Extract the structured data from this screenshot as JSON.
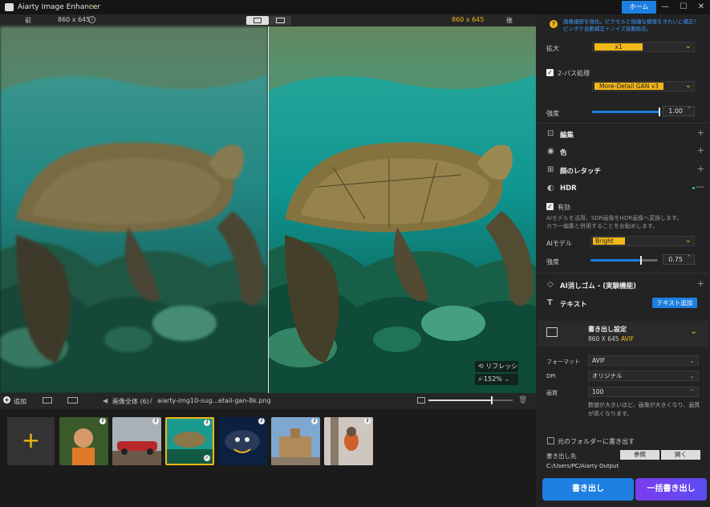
{
  "app": {
    "title": "Aiarty Image Enhancer",
    "home_label": "ホーム"
  },
  "compare": {
    "before_label": "前",
    "before_size": "860 x 645",
    "after_size": "860 x 645",
    "after_label": "後"
  },
  "overlay": {
    "refresh_label": "リフレッシュ",
    "zoom_value": "152%"
  },
  "bottom": {
    "add_label": "追加",
    "breadcrumb_all": "画像全体 (6)",
    "breadcrumb_sep": "/",
    "file_name": "aiarty-img10-sug...etail-gan-8k.png",
    "zoom_slider_value": 0.75
  },
  "thumbnails": [
    {
      "name": "child-photo",
      "selected": false
    },
    {
      "name": "red-car",
      "selected": false
    },
    {
      "name": "turtle",
      "selected": true
    },
    {
      "name": "dog",
      "selected": false
    },
    {
      "name": "castle",
      "selected": false
    },
    {
      "name": "bird",
      "selected": false
    }
  ],
  "panel": {
    "hint_line1": "画像細部を強化。ピクセルと微細な模様をきれいに補正！",
    "hint_line2": "ピンボケ自動補正＋ノイズ自動除去。",
    "scale_label": "拡大",
    "scale_value": "x1",
    "twopass_label": "2-パス処理",
    "twopass_checked": true,
    "twopass_model": "More-Detail GAN  v3",
    "strength_label": "強度",
    "strength_value": "1.00",
    "strength_fill": 1.0,
    "sections": {
      "edit": "編集",
      "color": "色",
      "face": "顔のレタッチ",
      "hdr": "HDR",
      "eraser": "AI消しゴム - (実験機能)",
      "text": "テキスト"
    },
    "hdr_enable_label": "有効",
    "hdr_enabled": true,
    "hdr_desc1": "AIモデルを活用、SDR画像をHDR画像へ変換します。",
    "hdr_desc2": "カラー編集と併用することをお勧めします。",
    "hdr_model_label": "AIモデル",
    "hdr_model_value": "Bright",
    "hdr_strength_label": "強度",
    "hdr_strength_value": "0.75",
    "hdr_strength_fill": 0.75,
    "text_add_button": "テキスト追加"
  },
  "export": {
    "title": "書き出し設定",
    "size": "860 X 645",
    "format_badge": "AVIF",
    "format_label": "フォーマット",
    "format_value": "AVIF",
    "dpi_label": "DPI",
    "dpi_value": "オリジナル",
    "quality_label": "画質",
    "quality_value": "100",
    "quality_desc1": "数値が大きいほど、画像が大きくなり、画質",
    "quality_desc2": "が高くなります。",
    "source_folder_label": "元のフォルダーに書き出す",
    "dest_label": "書き出し先",
    "browse_button": "参照",
    "open_button": "開く",
    "dest_path": "C:/Users/PC/Aiarty Output",
    "export_button": "書き出し",
    "batch_button": "一括書き出し"
  },
  "colors": {
    "accent": "#1d7fe0",
    "yellow": "#f2b718",
    "purple": "#7b3cf0"
  }
}
